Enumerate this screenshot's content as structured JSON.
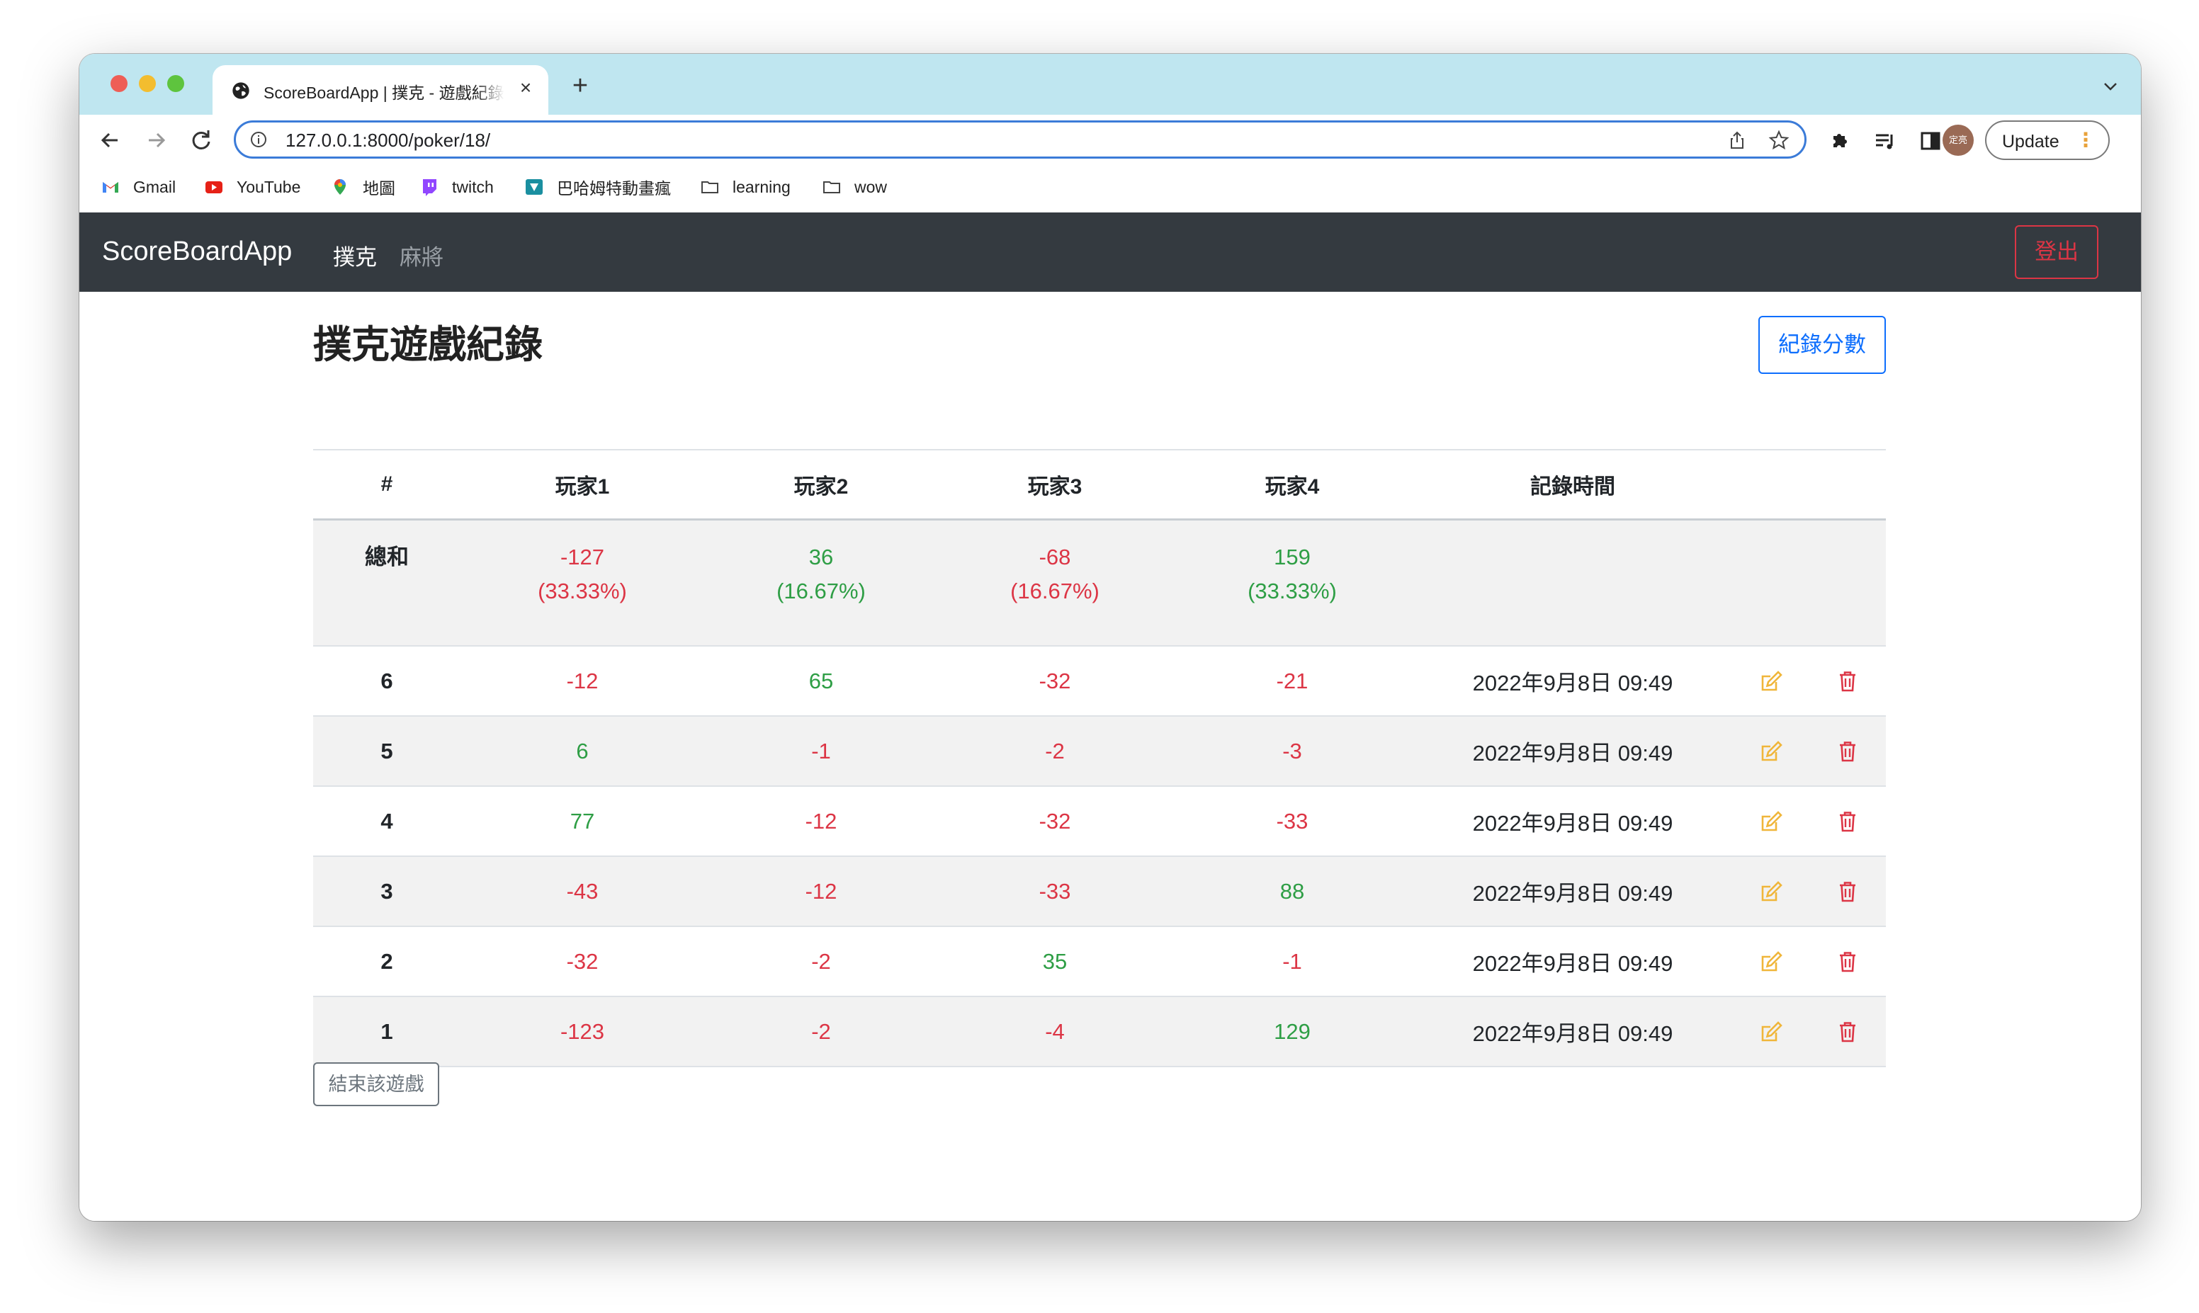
{
  "browser": {
    "tab_title": "ScoreBoardApp | 撲克 - 遊戲紀錄",
    "url": "127.0.0.1:8000/poker/18/",
    "update_label": "Update",
    "avatar_text": "定亮",
    "bookmarks": [
      {
        "label": "Gmail",
        "icon": "gmail-icon"
      },
      {
        "label": "YouTube",
        "icon": "youtube-icon"
      },
      {
        "label": "地圖",
        "icon": "maps-icon"
      },
      {
        "label": "twitch",
        "icon": "twitch-icon"
      },
      {
        "label": "巴哈姆特動畫瘋",
        "icon": "bahamut-icon"
      },
      {
        "label": "learning",
        "icon": "folder-icon"
      },
      {
        "label": "wow",
        "icon": "folder-icon"
      }
    ]
  },
  "navbar": {
    "brand": "ScoreBoardApp",
    "links": [
      "撲克",
      "麻將"
    ],
    "logout": "登出"
  },
  "main": {
    "heading": "撲克遊戲紀錄",
    "record_button": "紀錄分數",
    "end_button": "結束該遊戲"
  },
  "table": {
    "headers": [
      "#",
      "玩家1",
      "玩家2",
      "玩家3",
      "玩家4",
      "記錄時間"
    ],
    "sum": {
      "label": "總和",
      "totals": [
        "-127",
        "36",
        "-68",
        "159"
      ],
      "percents": [
        "(33.33%)",
        "(16.67%)",
        "(16.67%)",
        "(33.33%)"
      ]
    },
    "rows": [
      {
        "id": "6",
        "scores": [
          "-12",
          "65",
          "-32",
          "-21"
        ],
        "time": "2022年9月8日 09:49"
      },
      {
        "id": "5",
        "scores": [
          "6",
          "-1",
          "-2",
          "-3"
        ],
        "time": "2022年9月8日 09:49"
      },
      {
        "id": "4",
        "scores": [
          "77",
          "-12",
          "-32",
          "-33"
        ],
        "time": "2022年9月8日 09:49"
      },
      {
        "id": "3",
        "scores": [
          "-43",
          "-12",
          "-33",
          "88"
        ],
        "time": "2022年9月8日 09:49"
      },
      {
        "id": "2",
        "scores": [
          "-32",
          "-2",
          "35",
          "-1"
        ],
        "time": "2022年9月8日 09:49"
      },
      {
        "id": "1",
        "scores": [
          "-123",
          "-2",
          "-4",
          "129"
        ],
        "time": "2022年9月8日 09:49"
      }
    ]
  },
  "colors": {
    "positive": "#2e9e45",
    "negative": "#dc3545",
    "edit_icon": "#f0b63a",
    "delete_icon": "#dc3545",
    "navbar_bg": "#343a40",
    "primary": "#0d6efd"
  }
}
